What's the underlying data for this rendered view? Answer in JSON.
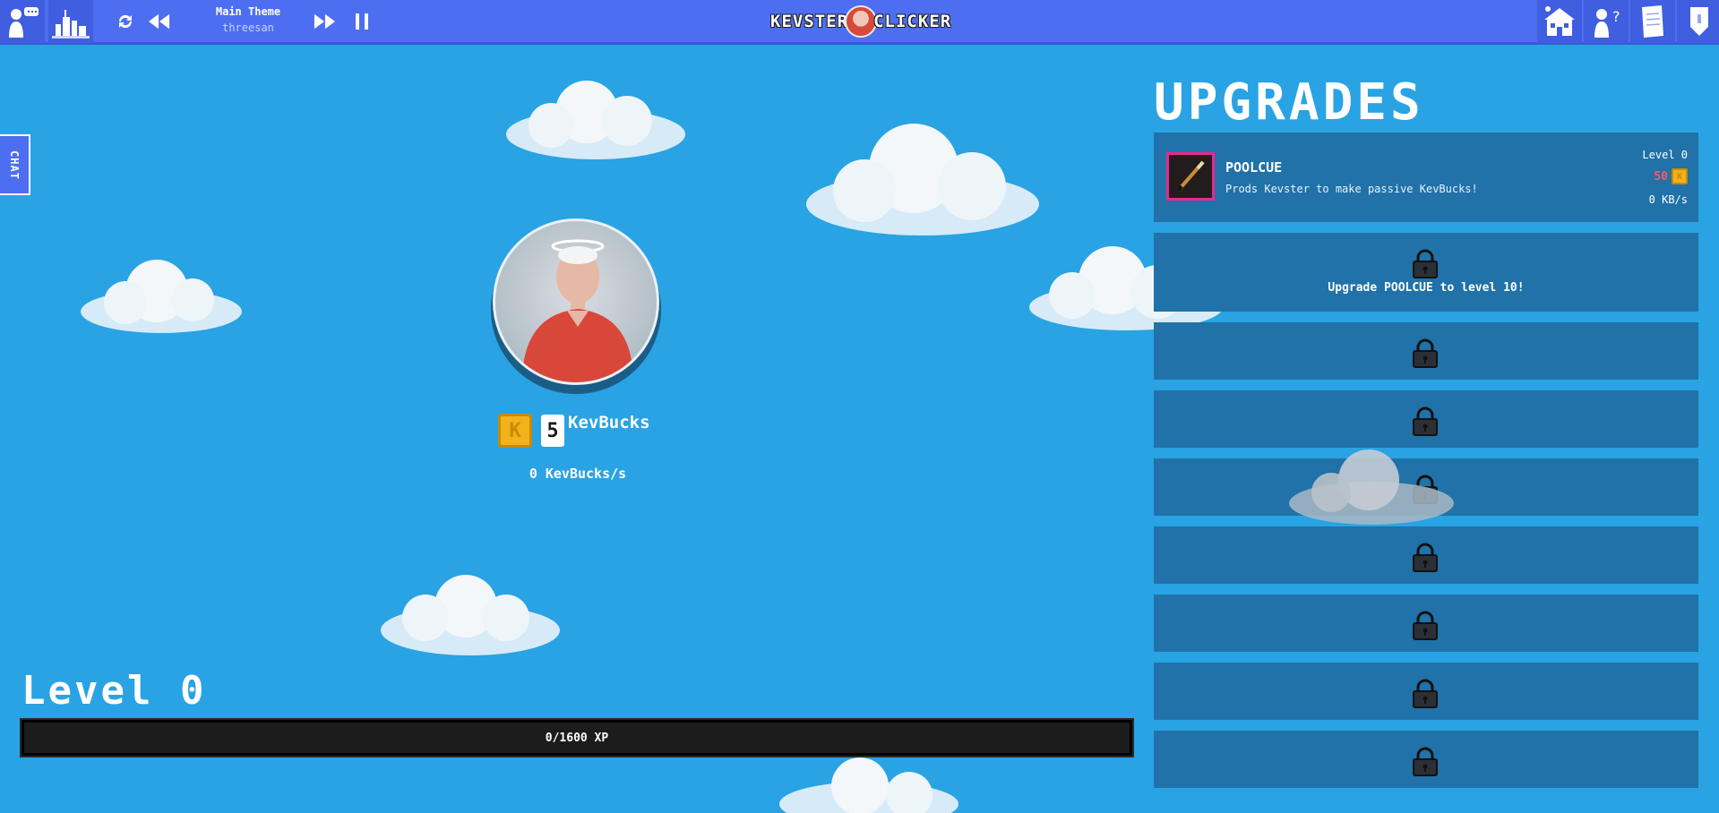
{
  "music": {
    "title": "Main Theme",
    "artist": "threesan"
  },
  "logo": {
    "left_word": "KEVSTER",
    "right_word": "CLICKER"
  },
  "chat": {
    "label": "CHAT"
  },
  "player": {
    "bucks_value": "5",
    "bucks_label": "KevBucks",
    "rate": "0 KevBucks/s",
    "level_label": "Level 0",
    "xp_text": "0/1600 XP",
    "xp_fraction": 0.0
  },
  "upgrades": {
    "title": "UPGRADES",
    "items": [
      {
        "name": "POOLCUE",
        "description": "Prods Kevster to make passive KevBucks!",
        "level": "Level 0",
        "cost": "50",
        "rate": "0 KB/s"
      }
    ],
    "locked_hint": "Upgrade POOLCUE to level 10!"
  },
  "colors": {
    "topbar": "#4d6ef0",
    "sky": "#29a3e3",
    "card": "#2072a8",
    "coin": "#f2b21a",
    "cost_red": "#ff5a5a",
    "icon_border": "#e62a8f"
  },
  "icons": {
    "topbar_left": [
      "profile-chat-icon",
      "city-icon"
    ],
    "music_controls": [
      "refresh-icon",
      "rewind-icon",
      "fast-forward-icon",
      "pause-icon"
    ],
    "topbar_right": [
      "home-icon",
      "help-icon",
      "paper-icon",
      "trophy-icon"
    ]
  }
}
